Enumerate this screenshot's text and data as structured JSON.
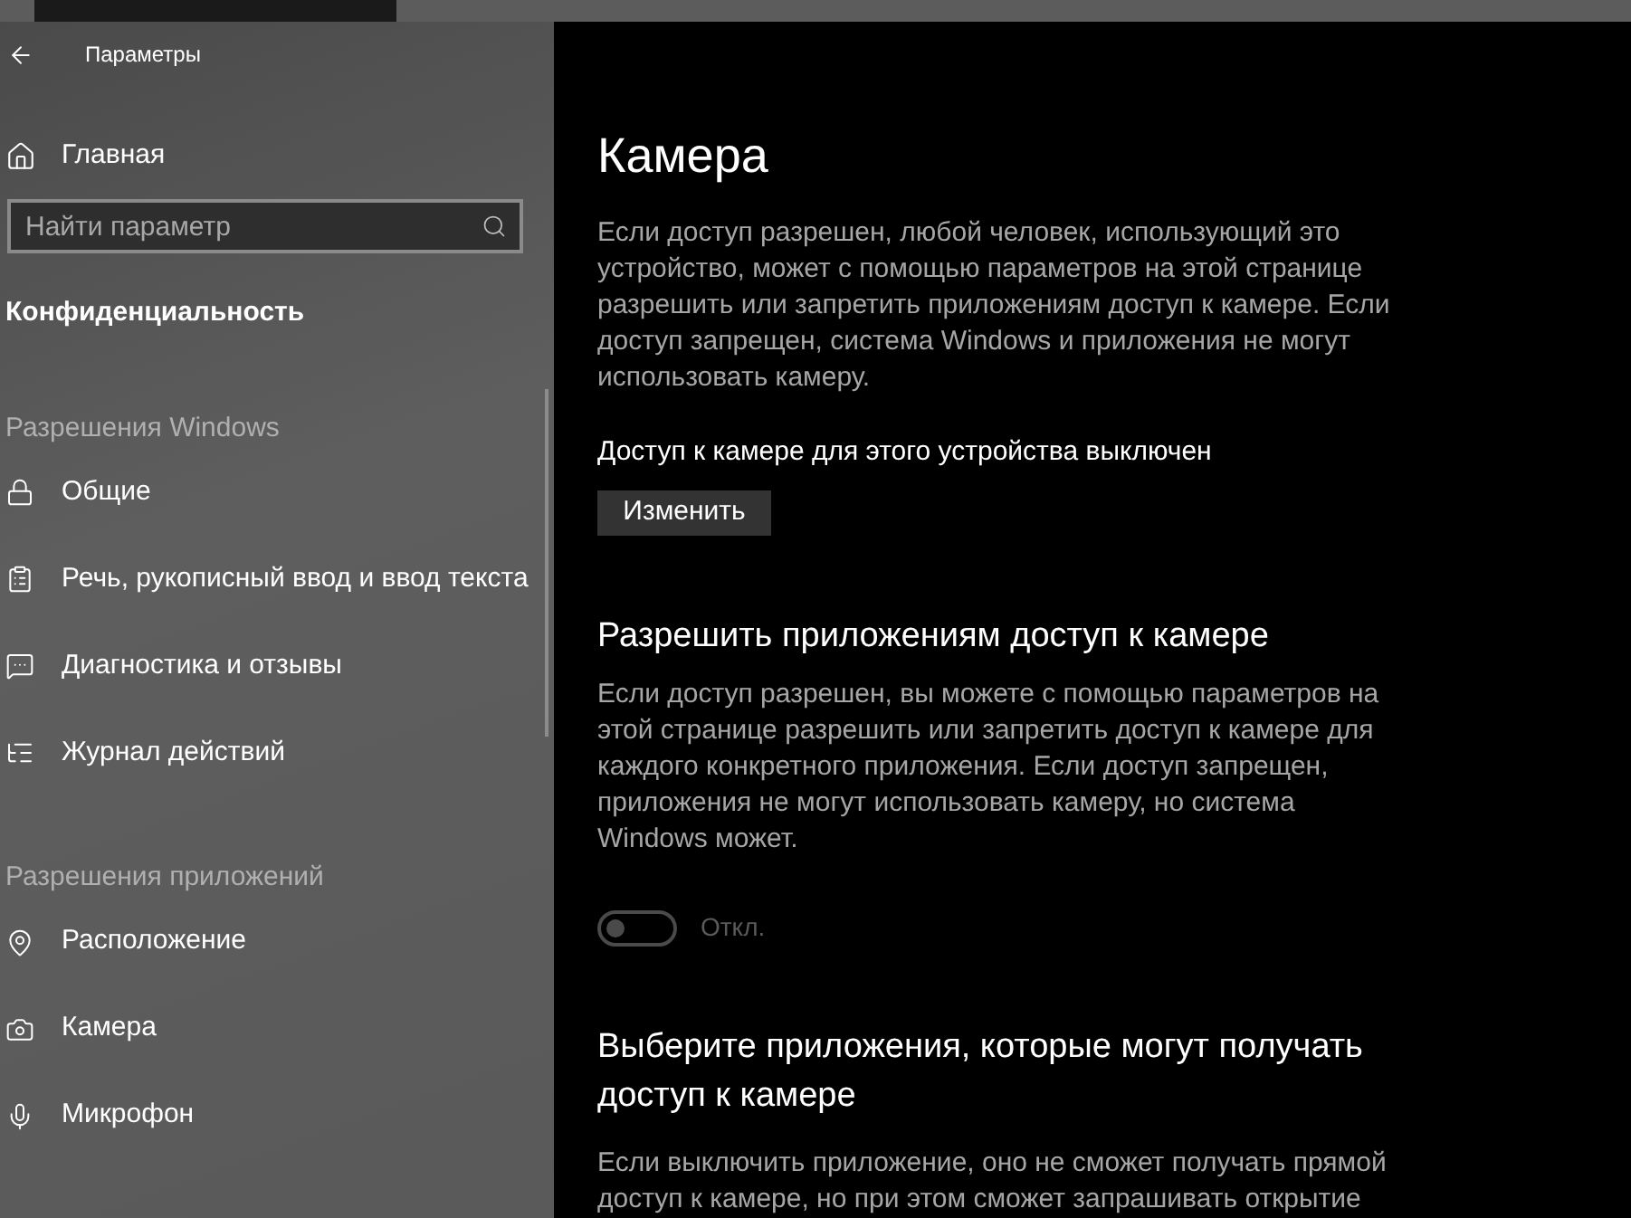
{
  "window": {
    "title": "Параметры"
  },
  "sidebar": {
    "home": "Главная",
    "search": {
      "placeholder": "Найти параметр"
    },
    "category": "Конфиденциальность",
    "groups": [
      {
        "title": "Разрешения Windows",
        "items": [
          {
            "label": "Общие"
          },
          {
            "label": "Речь, рукописный ввод и ввод текста"
          },
          {
            "label": "Диагностика и отзывы"
          },
          {
            "label": "Журнал действий"
          }
        ]
      },
      {
        "title": "Разрешения приложений",
        "items": [
          {
            "label": "Расположение"
          },
          {
            "label": "Камера"
          },
          {
            "label": "Микрофон"
          }
        ]
      }
    ]
  },
  "content": {
    "title": "Камера",
    "device_description": "Если доступ разрешен, любой человек, использующий это устройство, может с помощью параметров на этой странице разрешить или запретить приложениям доступ к камере. Если доступ запрещен, система Windows и приложения не могут использовать камеру.",
    "device_status": "Доступ к камере для этого устройства выключен",
    "change_button": "Изменить",
    "apps_heading": "Разрешить приложениям доступ к камере",
    "apps_description": "Если доступ разрешен, вы можете с помощью параметров на этой странице разрешить или запретить доступ к камере для каждого конкретного приложения. Если доступ запрещен, приложения не могут использовать камеру, но система Windows может.",
    "toggle": {
      "on": false,
      "disabled": true,
      "label": "Откл."
    },
    "choose_heading": "Выберите приложения, которые могут получать доступ к камере",
    "choose_description": "Если выключить приложение, оно не сможет получать прямой доступ к камере, но при этом сможет запрашивать открытие"
  }
}
